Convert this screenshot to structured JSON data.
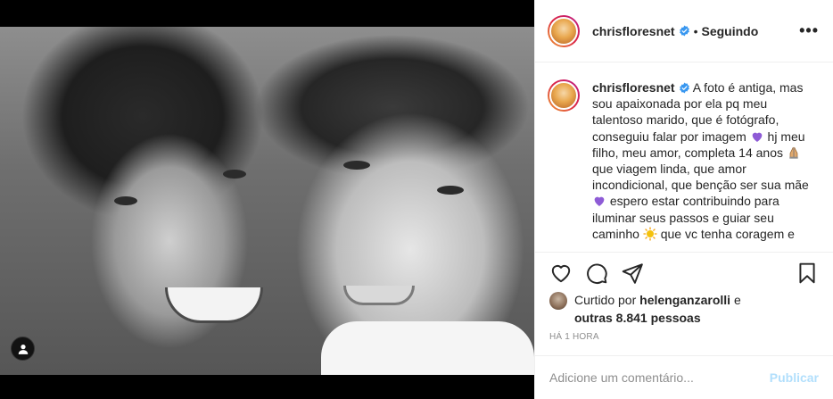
{
  "post": {
    "username": "chrisfloresnet",
    "separator": "•",
    "follow_status": "Seguindo",
    "more_label": "•••"
  },
  "caption": {
    "username": "chrisfloresnet",
    "part1": "A foto é antiga, mas sou apaixonada por ela pq meu talentoso marido, que é fotógrafo, conseguiu falar por imagem",
    "part2": "hj meu filho, meu amor, completa 14 anos",
    "part3": "que viagem linda, que amor incondicional, que benção ser sua mãe",
    "part4": "espero estar contribuindo para iluminar seus passos e guiar seu caminho",
    "part5": "que vc tenha coragem e",
    "emojis": [
      "purple-heart",
      "praying-hands",
      "purple-heart",
      "sun"
    ]
  },
  "likes": {
    "prefix": "Curtido por",
    "user": "helenganzarolli",
    "connector": "e",
    "others": "outras 8.841 pessoas"
  },
  "timestamp": "HÁ 1 HORA",
  "comment": {
    "placeholder": "Adicione um comentário...",
    "post_label": "Publicar"
  },
  "icons": [
    "heart-icon",
    "comment-icon",
    "share-icon",
    "bookmark-icon",
    "user-tag-icon",
    "verified-badge-icon",
    "more-options-icon"
  ],
  "colors": {
    "verified": "#3897f0",
    "post_button_disabled": "#b2dffc",
    "muted_text": "#8e8e8e",
    "emoji_purple": "#8e5bd6",
    "emoji_sun": "#f4c20d"
  }
}
